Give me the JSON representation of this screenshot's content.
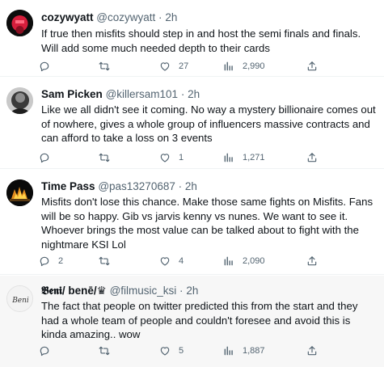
{
  "tweets": [
    {
      "name": "cozywyatt",
      "handle": "@cozywyatt",
      "time": "2h",
      "text": "If true then misfits should step in and host the semi finals and finals. Will add some much needed depth to their cards",
      "replies": "",
      "retweets": "",
      "likes": "27",
      "views": "2,990"
    },
    {
      "name": "Sam Picken",
      "handle": "@killersam101",
      "time": "2h",
      "text": "Like we all didn't see it coming. No way a mystery billionaire comes out of nowhere, gives a whole group of influencers massive contracts and can afford to take a loss on 3 events",
      "replies": "",
      "retweets": "",
      "likes": "1",
      "views": "1,271"
    },
    {
      "name": "Time Pass",
      "handle": "@pas13270687",
      "time": "2h",
      "text": "Misfits don't lose this chance. Make those same fights on Misfits. Fans will be so happy. Gib vs jarvis kenny vs nunes. We want to see it. Whoever brings the most value can be talked about to fight with the nightmare KSI Lol",
      "replies": "2",
      "retweets": "",
      "likes": "4",
      "views": "2,090"
    },
    {
      "name": "𝕭𝖊𝖓𝖎/ benē/♛",
      "handle": "@filmusic_ksi",
      "time": "2h",
      "text": "The fact that people on twitter predicted this from the start and they had a whole team of people and couldn't foresee and avoid this is kinda amazing.. wow",
      "replies": "",
      "retweets": "",
      "likes": "5",
      "views": "1,887",
      "avatar_text": "Beni"
    }
  ],
  "dot": "·",
  "colors": {
    "text_primary": "#0f1419",
    "text_secondary": "#536471",
    "hover_bg": "#f7f7f7",
    "divider": "#eff3f4"
  }
}
